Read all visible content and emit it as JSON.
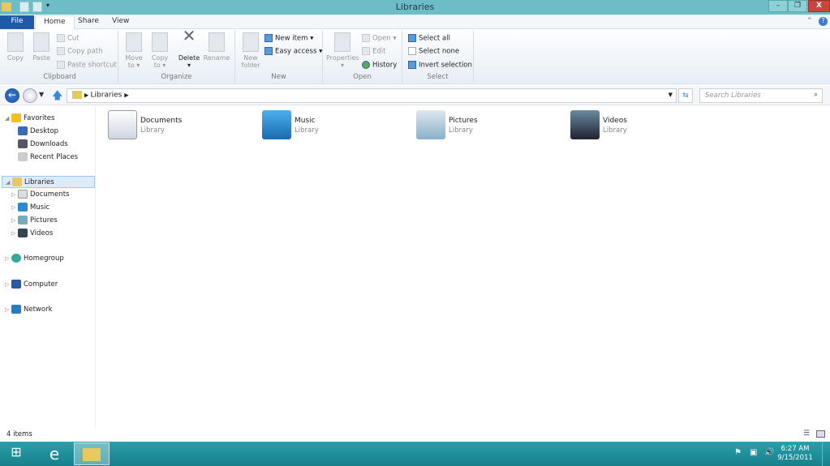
{
  "window": {
    "title": "Libraries",
    "minimize": "–",
    "restore": "❐",
    "close": "X"
  },
  "tabs": [
    "File",
    "Home",
    "Share",
    "View"
  ],
  "ribbon": {
    "clipboard": {
      "label": "Clipboard",
      "copy": "Copy",
      "paste": "Paste",
      "cut": "Cut",
      "copy_path": "Copy path",
      "paste_shortcut": "Paste shortcut"
    },
    "organize": {
      "label": "Organize",
      "move_to": "Move to ▾",
      "copy_to": "Copy to ▾",
      "delete": "Delete ▾",
      "rename": "Rename"
    },
    "new": {
      "label": "New",
      "new_folder": "New folder",
      "new_item": "New item ▾",
      "easy_access": "Easy access ▾"
    },
    "open": {
      "label": "Open",
      "properties": "Properties ▾",
      "open": "Open ▾",
      "edit": "Edit",
      "history": "History"
    },
    "select": {
      "label": "Select",
      "select_all": "Select all",
      "select_none": "Select none",
      "invert": "Invert selection"
    }
  },
  "address": {
    "path": "Libraries",
    "search_placeholder": "Search Libraries"
  },
  "nav": {
    "favorites": {
      "label": "Favorites",
      "items": [
        "Desktop",
        "Downloads",
        "Recent Places"
      ]
    },
    "libraries": {
      "label": "Libraries",
      "items": [
        "Documents",
        "Music",
        "Pictures",
        "Videos"
      ]
    },
    "homegroup": "Homegroup",
    "computer": "Computer",
    "network": "Network"
  },
  "libraries": [
    {
      "name": "Documents",
      "type": "Library"
    },
    {
      "name": "Music",
      "type": "Library"
    },
    {
      "name": "Pictures",
      "type": "Library"
    },
    {
      "name": "Videos",
      "type": "Library"
    }
  ],
  "status": {
    "count": "4 items"
  },
  "taskbar": {
    "time": "6:27 AM",
    "date": "9/15/2011"
  },
  "colors": {
    "titlebar": "#6cbdc6",
    "file_tab": "#1e5aa8",
    "taskbar": "#1f8f9a",
    "selection": "#dcecfc"
  }
}
